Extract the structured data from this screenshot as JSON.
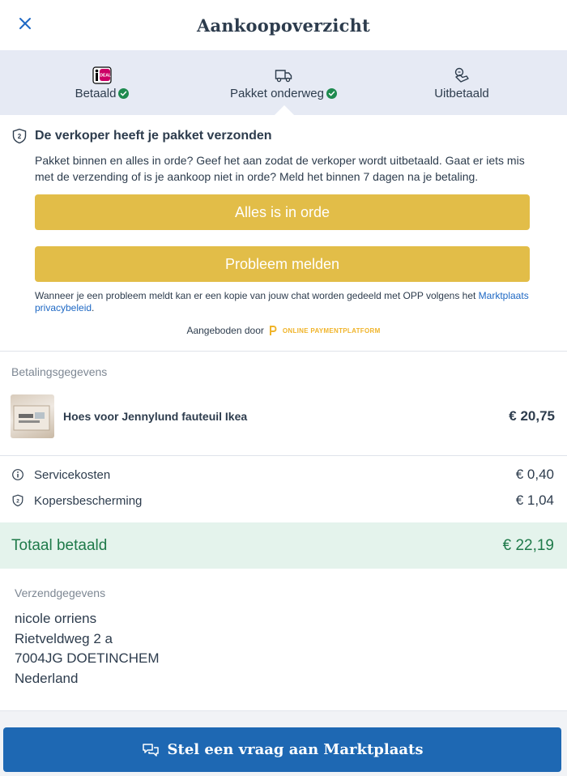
{
  "header": {
    "title": "Aankoopoverzicht",
    "close_icon": "close-icon"
  },
  "steps": [
    {
      "label": "Betaald",
      "icon": "ideal-icon",
      "done": true
    },
    {
      "label": "Pakket onderweg",
      "icon": "truck-icon",
      "done": true
    },
    {
      "label": "Uitbetaald",
      "icon": "hand-coin-icon",
      "done": false
    }
  ],
  "notice": {
    "title": "De verkoper heeft je pakket verzonden",
    "body": "Pakket binnen en alles in orde? Geef het aan zodat de verkoper wordt uitbetaald. Gaat er iets mis met de verzending of is je aankoop niet in orde? Meld het binnen 7 dagen na je betaling.",
    "ok_button": "Alles is in orde",
    "problem_button": "Probleem melden",
    "disclaimer": "Wanneer je een probleem meldt kan er een kopie van jouw chat worden gedeeld met OPP volgens het ",
    "privacy_link": "Marktplaats privacybeleid",
    "disclaimer_end": ".",
    "offered_by": "Aangeboden door",
    "provider": "ONLINE PAYMENTPLATFORM"
  },
  "payment": {
    "section_label": "Betalingsgegevens",
    "product_name": "Hoes voor Jennylund fauteuil Ikea",
    "product_price": "€ 20,75",
    "fees": [
      {
        "label": "Servicekosten",
        "value": "€ 0,40",
        "icon": "info-icon"
      },
      {
        "label": "Kopersbescherming",
        "value": "€ 1,04",
        "icon": "shield-icon"
      }
    ],
    "total_label": "Totaal betaald",
    "total_value": "€ 22,19"
  },
  "shipping": {
    "section_label": "Verzendgegevens",
    "lines": [
      "nicole orriens",
      "Rietveldweg 2 a",
      "7004JG DOETINCHEM",
      "Nederland"
    ]
  },
  "footer": {
    "ask_button": "Stel een vraag aan Marktplaats"
  },
  "colors": {
    "accent_yellow": "#e2bd48",
    "brand_blue": "#1e68b3",
    "success_green": "#1f7a4a",
    "steps_bg": "#e6eaf4"
  }
}
